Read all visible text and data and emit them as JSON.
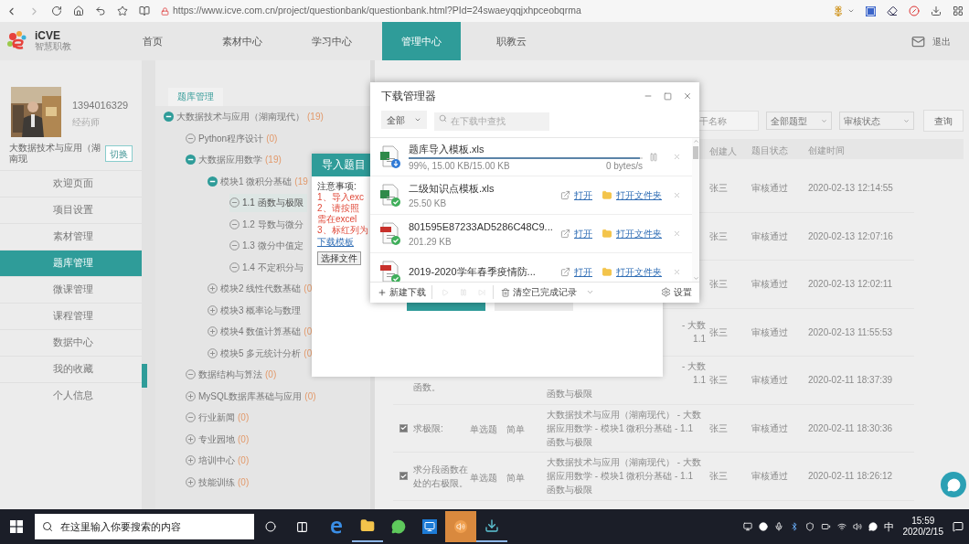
{
  "browser": {
    "url": "https://www.icve.com.cn/project/questionbank/questionbank.html?PId=24swaeyqqjxhpceobqrma"
  },
  "site_header": {
    "logo_text": "iCVE",
    "logo_subtitle": "智慧职教",
    "logout": "退出",
    "nav": [
      {
        "label": "首页",
        "selected": false
      },
      {
        "label": "素材中心",
        "selected": false
      },
      {
        "label": "学习中心",
        "selected": false
      },
      {
        "label": "管理中心",
        "selected": true
      },
      {
        "label": "职教云",
        "selected": false
      }
    ]
  },
  "profile": {
    "account": "1394016329",
    "role": "经药师",
    "project": "大数据技术与应用（湖南现",
    "switch_button": "切换"
  },
  "sidebar": {
    "items": [
      {
        "label": "欢迎页面",
        "selected": false
      },
      {
        "label": "项目设置",
        "selected": false
      },
      {
        "label": "素材管理",
        "selected": false
      },
      {
        "label": "题库管理",
        "selected": true
      },
      {
        "label": "微课管理",
        "selected": false
      },
      {
        "label": "课程管理",
        "selected": false
      },
      {
        "label": "数据中心",
        "selected": false
      },
      {
        "label": "我的收藏",
        "selected": false
      },
      {
        "label": "个人信息",
        "selected": false
      }
    ]
  },
  "tree": {
    "tab": "题库管理",
    "items": [
      {
        "label": "大数据技术与应用（湖南现代）",
        "count": "(19)",
        "kind": "open",
        "selected": false,
        "children": [
          {
            "label": "Python程序设计",
            "count": "(0)",
            "kind": "empty",
            "selected": false
          },
          {
            "label": "大数据应用数学",
            "count": "(19)",
            "kind": "open",
            "selected": false,
            "children": [
              {
                "label": "模块1 微积分基础",
                "count": "(19",
                "kind": "open",
                "selected": false,
                "children": [
                  {
                    "label": "1.1 函数与极限",
                    "kind": "empty",
                    "selected": true
                  },
                  {
                    "label": "1.2 导数与微分",
                    "kind": "empty",
                    "selected": false
                  },
                  {
                    "label": "1.3 微分中值定",
                    "kind": "empty",
                    "selected": false
                  },
                  {
                    "label": "1.4 不定积分与",
                    "kind": "empty",
                    "selected": false
                  }
                ]
              },
              {
                "label": "模块2 线性代数基础",
                "count": "(0",
                "kind": "closed",
                "selected": false
              },
              {
                "label": "模块3 概率论与数理",
                "kind": "closed",
                "selected": false
              },
              {
                "label": "模块4 数值计算基础",
                "count": "(0",
                "kind": "closed",
                "selected": false
              },
              {
                "label": "模块5 多元统计分析",
                "count": "(0",
                "kind": "closed",
                "selected": false
              }
            ]
          },
          {
            "label": "数据结构与算法",
            "count": "(0)",
            "kind": "empty",
            "selected": false
          },
          {
            "label": "MySQL数据库基础与应用",
            "count": "(0)",
            "kind": "closed",
            "selected": false
          },
          {
            "label": "行业新闻",
            "count": "(0)",
            "kind": "empty",
            "selected": false
          },
          {
            "label": "专业园地",
            "count": "(0)",
            "kind": "closed",
            "selected": false
          },
          {
            "label": "培训中心",
            "count": "(0)",
            "kind": "closed",
            "selected": false
          },
          {
            "label": "技能训练",
            "count": "(0)",
            "kind": "closed",
            "selected": false
          }
        ]
      }
    ]
  },
  "filters": {
    "name_placeholder": "干名称",
    "type_select": "全部题型",
    "status_select": "审核状态",
    "search_button": "查询"
  },
  "table": {
    "columns": [
      "创建人",
      "题目状态",
      "创建时间"
    ],
    "rows": [
      {
        "creator": "张三",
        "status": "审核通过",
        "time": "2020-02-13 12:14:55"
      },
      {
        "creator": "张三",
        "status": "审核通过",
        "time": "2020-02-13 12:07:16"
      },
      {
        "creator": "张三",
        "status": "审核通过",
        "time": "2020-02-13 12:02:11"
      },
      {
        "path_tail": [
          "- 大数",
          "1.1"
        ],
        "creator": "张三",
        "status": "审核通过",
        "time": "2020-02-13 11:55:53"
      },
      {
        "title": [
          "函数。"
        ],
        "title_continued": true,
        "path_tail": [
          "- 大数",
          "1.1"
        ],
        "path": [
          "函数与极限"
        ],
        "creator": "张三",
        "status": "审核通过",
        "time": "2020-02-11 18:37:39"
      },
      {
        "checked": true,
        "title": [
          "求极限:"
        ],
        "type": "单选题",
        "difficulty": "简单",
        "path": [
          "大数据技术与应用（湖南现代） - 大数",
          "据应用数学 - 模块1 微积分基础 - 1.1",
          "函数与极限"
        ],
        "creator": "张三",
        "status": "审核通过",
        "time": "2020-02-11 18:30:36"
      },
      {
        "checked": true,
        "title": [
          "求分段函数在",
          "处的右极限。"
        ],
        "type": "单选题",
        "difficulty": "简单",
        "path": [
          "大数据技术与应用（湖南现代） - 大数",
          "据应用数学 - 模块1 微积分基础 - 1.1",
          "函数与极限"
        ],
        "creator": "张三",
        "status": "审核通过",
        "time": "2020-02-11 18:26:12"
      }
    ]
  },
  "import_dialog": {
    "title": "导入题目",
    "notes_heading": "注意事项:",
    "notes": [
      "1、导入exc",
      "2、请按照",
      "需在excel",
      "3、标红列为"
    ],
    "template_link": "下载模板",
    "file_button": "选择文件"
  },
  "download_manager": {
    "title": "下载管理器",
    "filter": "全部",
    "search_placeholder": "在下载中查找",
    "items": [
      {
        "name": "题库导入模板.xls",
        "kind": "excel",
        "downloading": true,
        "level": 0.99,
        "progress_text": "99%, 15.00 KB/15.00 KB",
        "speed": "0 bytes/s"
      },
      {
        "name": "二级知识点模板.xls",
        "kind": "excel",
        "downloading": false,
        "size": "25.50 KB",
        "open": "打开",
        "open_folder": "打开文件夹"
      },
      {
        "name": "801595E87233AD5286C48C9...",
        "kind": "pdf",
        "downloading": false,
        "size": "201.29 KB",
        "open": "打开",
        "open_folder": "打开文件夹"
      },
      {
        "name": "2019-2020学年春季疫情防...",
        "kind": "pdf",
        "downloading": false,
        "open": "打开",
        "open_folder": "打开文件夹"
      }
    ],
    "new_download": "新建下载",
    "clear_completed": "清空已完成记录",
    "settings": "设置"
  },
  "taskbar": {
    "search_placeholder": "在这里输入你要搜索的内容",
    "ime": "中",
    "time": "15:59",
    "date": "2020/2/15"
  }
}
